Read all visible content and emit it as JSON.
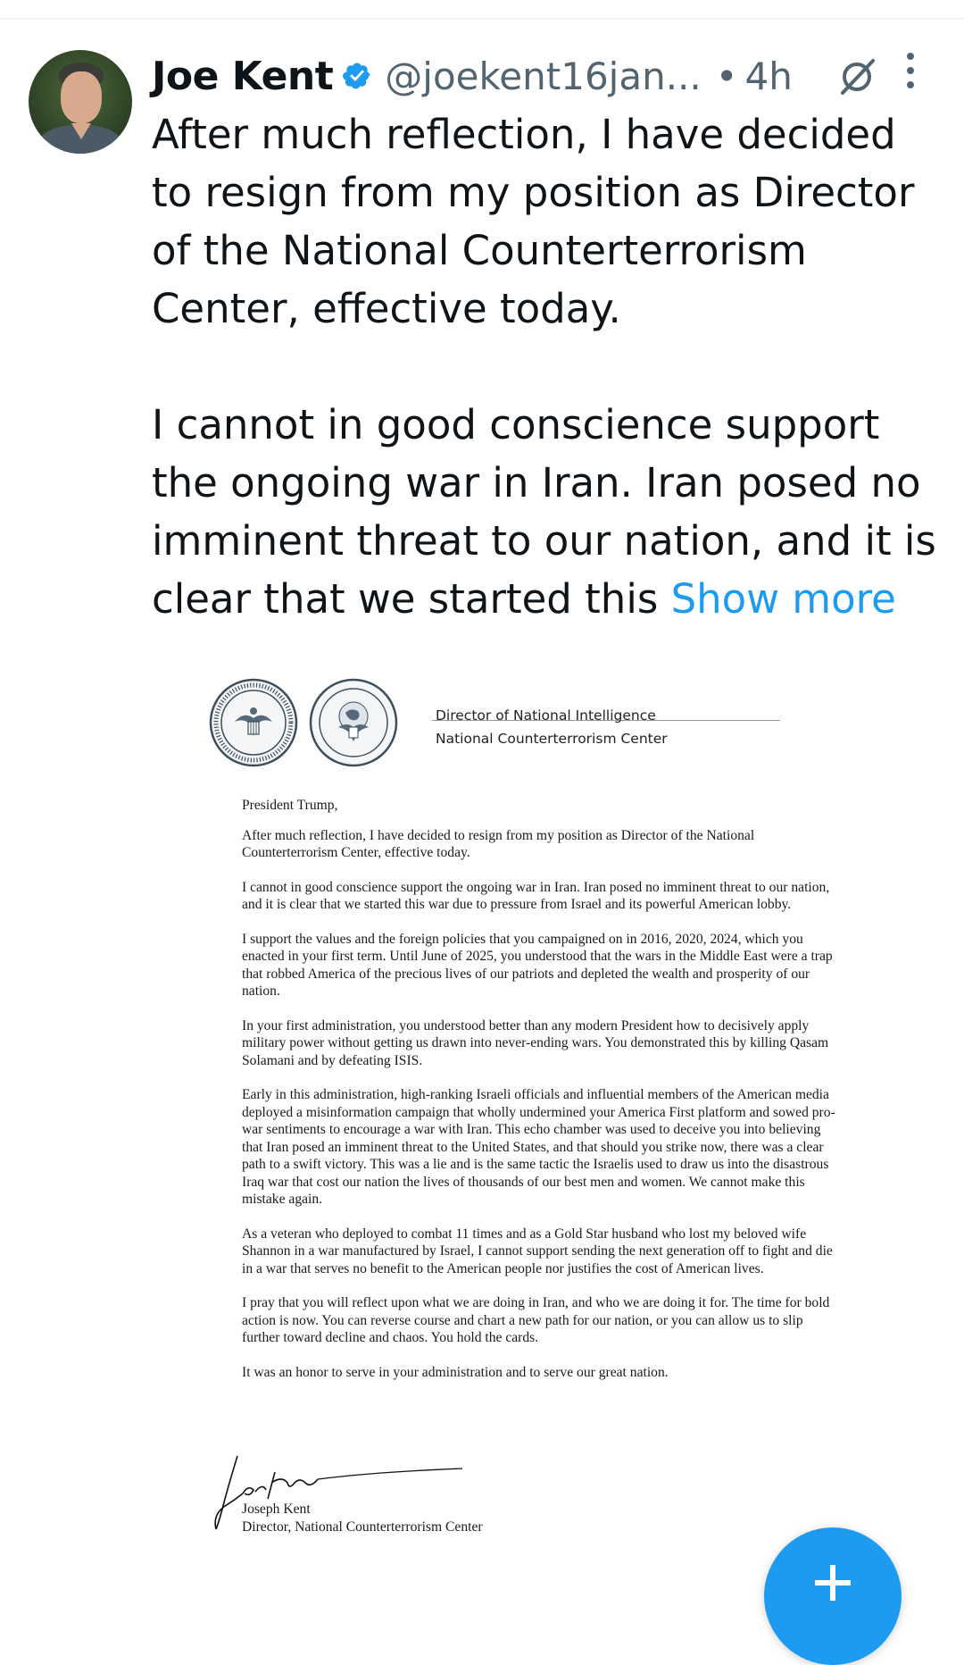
{
  "post": {
    "author": {
      "display_name": "Joe Kent",
      "handle": "@joekent16jan...",
      "verified": true,
      "verified_color": "#1d9bf0"
    },
    "separator": "•",
    "time_ago": "4h",
    "text_part1": "After much reflection, I have decided to resign from my position as Director of the National Counterterrorism Center, effective today.\n\nI cannot in good conscience support the ongoing war in Iran. Iran posed no imminent threat to our nation, and it is clear that we started this ",
    "show_more": "Show more",
    "icons": [
      "avatar",
      "verified-badge-icon",
      "grok-icon",
      "more-options-icon"
    ]
  },
  "letter": {
    "letterhead_line1": "Director of National Intelligence",
    "letterhead_line2": "National Counterterrorism Center",
    "seal1_label": "OFFICE OF THE DIRECTOR OF NATIONAL INTELLIGENCE · UNITED STATES OF AMERICA",
    "seal2_label": "NATIONAL COUNTERTERRORISM CENTER · UNITED STATES OF AMERICA",
    "salutation": "President Trump,",
    "paragraphs": [
      "After much reflection, I have decided to resign from my position as Director of the National Counterterrorism Center, effective today.",
      "I cannot in good conscience support the ongoing war in Iran. Iran posed no imminent threat to our nation, and it is clear that we started this war due to pressure from Israel and its powerful American lobby.",
      "I support the values and the foreign policies that you campaigned on in 2016, 2020, 2024, which you enacted in your first term. Until June of 2025, you understood that the wars in the Middle East were a trap that robbed America of the precious lives of our patriots and depleted the wealth and prosperity of our nation.",
      "In your first administration, you understood better than any modern President how to decisively apply military power without getting us drawn into never-ending wars. You demonstrated this by killing Qasam Solamani and by defeating ISIS.",
      "Early in this administration, high-ranking Israeli officials and influential members of the American media deployed a misinformation campaign that wholly undermined your America First platform and sowed pro-war sentiments to encourage a war with Iran. This echo chamber was used to deceive you into believing that Iran posed an imminent threat to the United States, and that should you strike now, there was a clear path to a swift victory. This was a lie and is the same tactic the Israelis used to draw us into the disastrous Iraq war that cost our nation the lives of thousands of our best men and women. We cannot make this mistake again.",
      "As a veteran who deployed to combat 11 times and as a Gold Star husband who lost my beloved wife Shannon in a war manufactured by Israel, I cannot support sending the next generation off to fight and die in a war that serves no benefit to the American people nor justifies the cost of American lives.",
      "I pray that you will reflect upon what we are doing in Iran, and who we are doing it for. The time for bold action is now. You can reverse course and chart a new path for our nation, or you can allow us to slip further toward decline and chaos. You hold the cards.",
      "It was an honor to serve in your administration and to serve our great nation."
    ],
    "signature_script": "Joe Kent",
    "signer_name": "Joseph Kent",
    "signer_title": "Director, National Counterterrorism Center"
  },
  "fab": {
    "icon": "plus-icon",
    "color": "#1d9bf0"
  }
}
